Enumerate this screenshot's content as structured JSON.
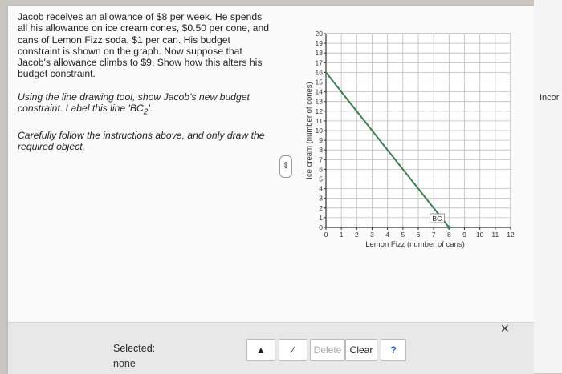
{
  "question": {
    "paragraph1": "Jacob receives an allowance of $8 per week. He spends all his allowance on ice cream cones, $0.50 per cone, and cans of Lemon Fizz soda, $1 per can. His budget constraint is shown on the graph. Now suppose that Jacob's allowance climbs to $9. Show how this alters his budget constraint.",
    "paragraph2_prefix": "Using the line drawing tool, show Jacob's new budget constraint. Label this line 'BC",
    "paragraph2_sub": "2",
    "paragraph2_suffix": "'.",
    "paragraph3": "Carefully follow the instructions above, and only draw the required object."
  },
  "side_status": "Incor",
  "chart_data": {
    "type": "line",
    "xlabel": "Lemon Fizz (number of cans)",
    "ylabel": "Ice cream (number of cones)",
    "xlim": [
      0,
      12
    ],
    "ylim": [
      0,
      20
    ],
    "x_ticks": [
      0,
      1,
      2,
      3,
      4,
      5,
      6,
      7,
      8,
      9,
      10,
      11,
      12
    ],
    "y_ticks": [
      0,
      1,
      2,
      3,
      4,
      5,
      6,
      7,
      8,
      9,
      10,
      11,
      12,
      13,
      14,
      15,
      16,
      17,
      18,
      19,
      20
    ],
    "grid": true,
    "series": [
      {
        "name": "BC",
        "x": [
          0,
          8
        ],
        "y": [
          16,
          0
        ]
      }
    ],
    "line_color": "#3a7d4f"
  },
  "toolbar": {
    "selected_label": "Selected:",
    "selected_value": "none",
    "delete_label": "Delete",
    "clear_label": "Clear",
    "help_label": "?"
  }
}
